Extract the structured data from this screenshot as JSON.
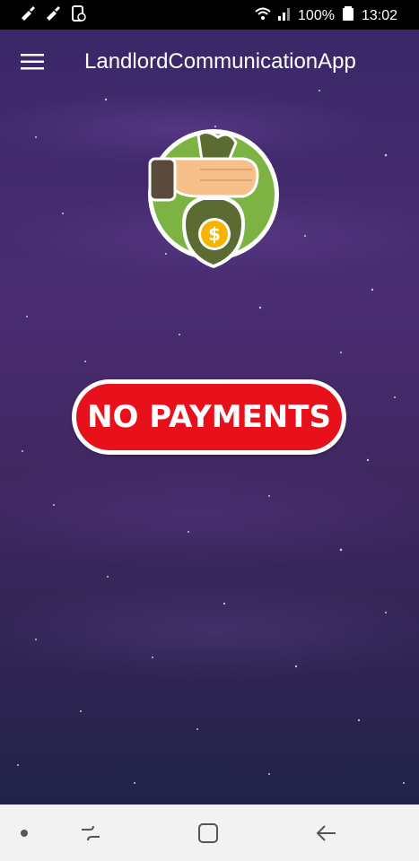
{
  "status_bar": {
    "battery": "100%",
    "time": "13:02",
    "icons": [
      "broom-icon",
      "broom-icon",
      "screen-record-icon",
      "wifi-icon",
      "signal-icon",
      "battery-icon"
    ]
  },
  "app_bar": {
    "title": "LandlordCommunicationApp",
    "menu_icon": "hamburger-menu-icon"
  },
  "main": {
    "badge_icon": "hand-money-bag-icon",
    "status_label": "NO PAYMENTS"
  },
  "nav_bar": {
    "items": [
      "dot-icon",
      "recent-apps-icon",
      "home-icon",
      "back-icon"
    ]
  },
  "colors": {
    "accent_red": "#e8101b",
    "badge_green": "#7cb342",
    "background_purple": "#3e275f"
  }
}
